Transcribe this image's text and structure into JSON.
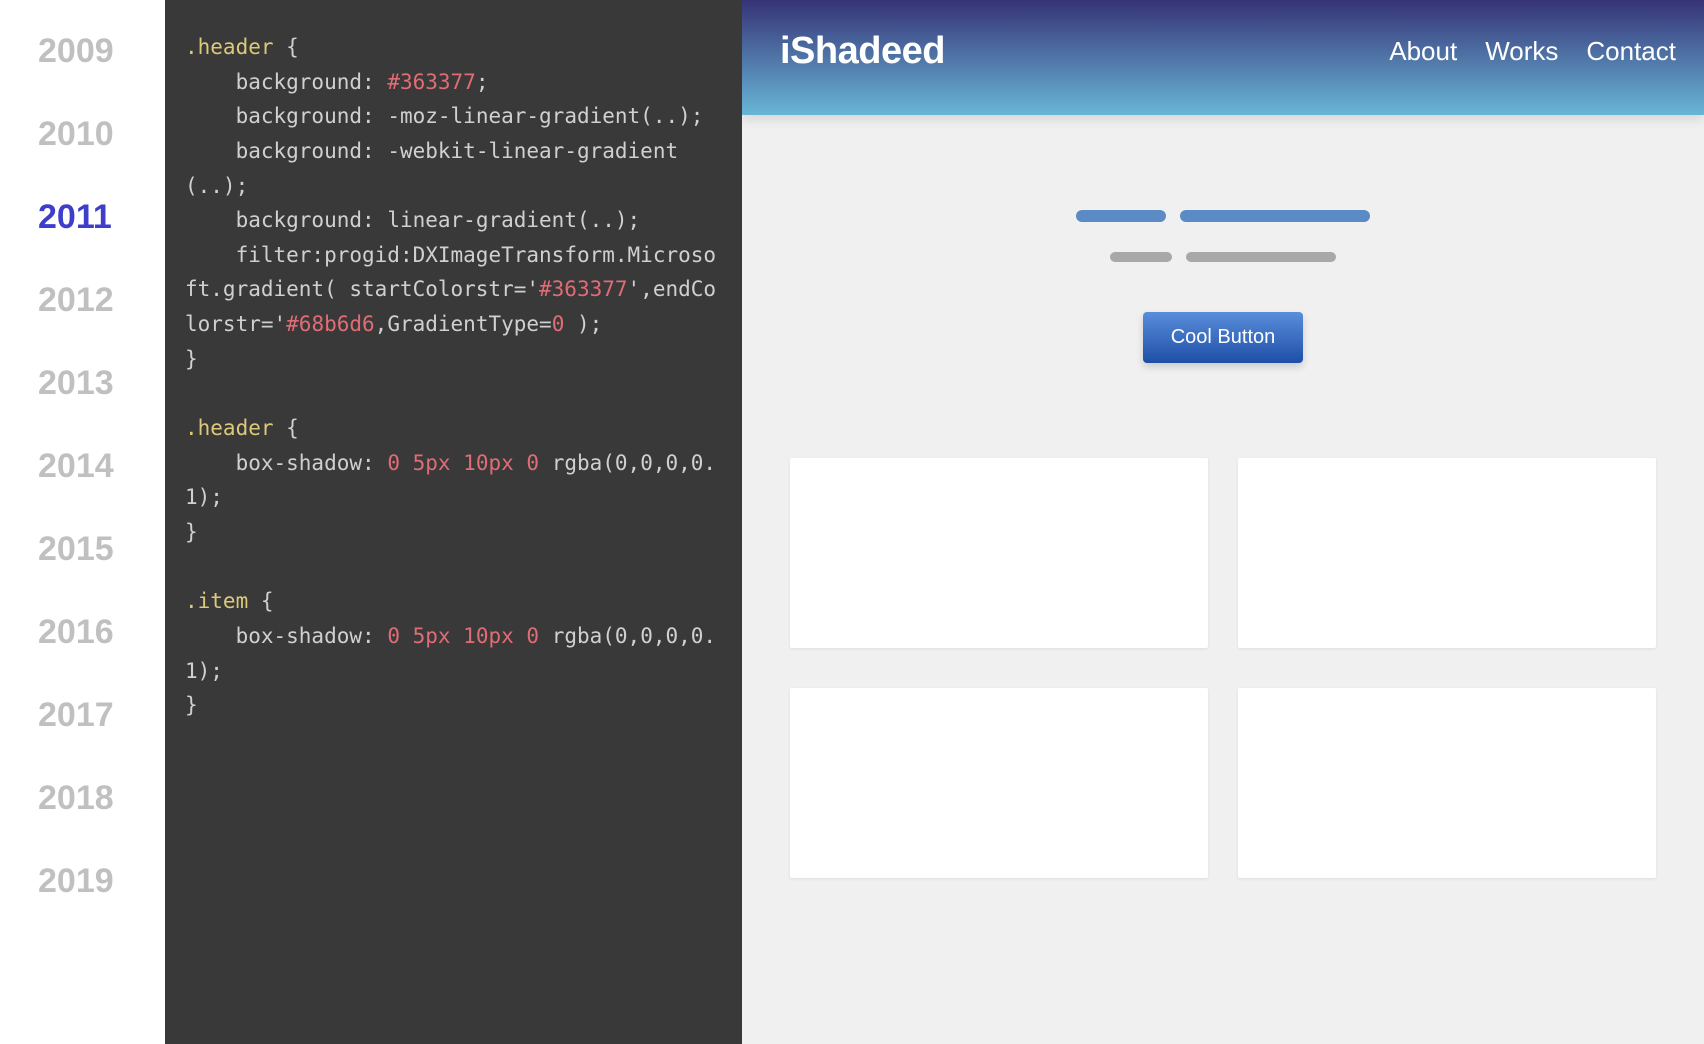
{
  "years": {
    "items": [
      "2009",
      "2010",
      "2011",
      "2012",
      "2013",
      "2014",
      "2015",
      "2016",
      "2017",
      "2018",
      "2019"
    ],
    "active": "2011"
  },
  "code": {
    "block1": {
      "selector": ".header",
      "lines": [
        {
          "prop": "background",
          "val": "#363377",
          "type": "color"
        },
        {
          "prop": "background",
          "val": "-moz-linear-gradient(..)",
          "type": "func"
        },
        {
          "prop": "background",
          "val": "-webkit-linear-gradient(..)",
          "type": "func"
        },
        {
          "prop": "background",
          "val": "linear-gradient(..)",
          "type": "func"
        }
      ],
      "filter_prefix": "filter:progid",
      "filter_mid1": ":DXImageTransform.Microsoft.gradient( startColorstr='",
      "filter_color1": "#363377",
      "filter_mid2": "',endColorstr='",
      "filter_color2": "#68b6d6",
      "filter_mid3": ",GradientType=",
      "filter_zero": "0",
      "filter_end": " );"
    },
    "block2": {
      "selector": ".header",
      "prop": "box-shadow",
      "nums": "0 5px 10px 0",
      "rest": "rgba(0,0,0,0.1);"
    },
    "block3": {
      "selector": ".item",
      "prop": "box-shadow",
      "nums": "0 5px 10px 0",
      "rest": "rgba(0,0,0,0.1);"
    }
  },
  "preview": {
    "logo": "iShadeed",
    "nav": [
      "About",
      "Works",
      "Contact"
    ],
    "button": "Cool Button"
  }
}
